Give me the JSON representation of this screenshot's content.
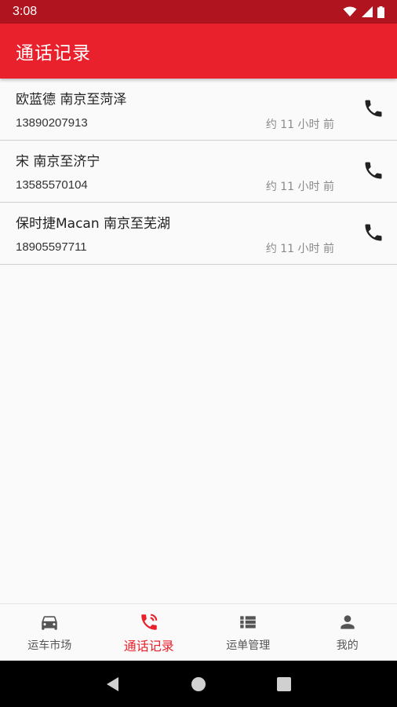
{
  "status_bar": {
    "time": "3:08"
  },
  "app_bar": {
    "title": "通话记录"
  },
  "records": [
    {
      "title": "欧蓝德 南京至菏泽",
      "phone": "13890207913",
      "time": "约 11 小时 前"
    },
    {
      "title": "宋 南京至济宁",
      "phone": "13585570104",
      "time": "约 11 小时 前"
    },
    {
      "title": "保时捷Macan 南京至芜湖",
      "phone": "18905597711",
      "time": "约 11 小时 前"
    }
  ],
  "bottom_nav": {
    "items": [
      {
        "label": "运车市场",
        "icon": "car-icon"
      },
      {
        "label": "通话记录",
        "icon": "phone-ring-icon"
      },
      {
        "label": "运单管理",
        "icon": "list-icon"
      },
      {
        "label": "我的",
        "icon": "person-icon"
      }
    ],
    "active_index": 1
  },
  "colors": {
    "primary": "#e8212c",
    "status_bar": "#b0151f",
    "inactive": "#555555"
  }
}
